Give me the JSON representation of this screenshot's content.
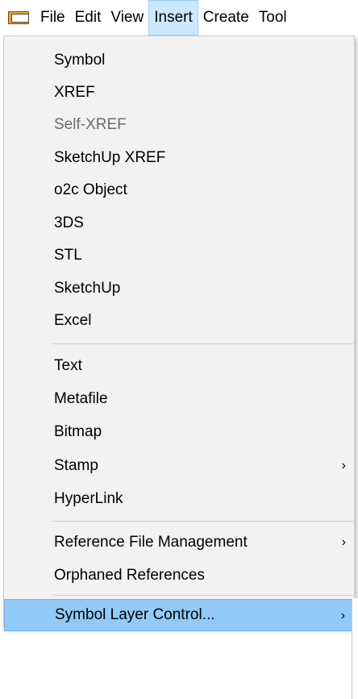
{
  "menubar": {
    "app_icon": "folder-window-icon",
    "items": [
      "File",
      "Edit",
      "View",
      "Insert",
      "Create",
      "Tool"
    ],
    "active_index": 3
  },
  "menu": {
    "groups": [
      [
        "Symbol",
        "XREF",
        "Self-XREF",
        "SketchUp XREF",
        "o2c Object",
        "3DS",
        "STL",
        "SketchUp",
        "Excel"
      ],
      [
        "Text",
        "Metafile",
        "Bitmap",
        "Stamp",
        "HyperLink"
      ],
      [
        "Reference File Management",
        "Orphaned References"
      ],
      [
        "Symbol Layer Control..."
      ]
    ],
    "disabled": [
      "Self-XREF"
    ],
    "has_submenu": [
      "Stamp",
      "Reference File Management",
      "Symbol Layer Control..."
    ],
    "highlighted": "Symbol Layer Control...",
    "submenu_glyph": "›"
  },
  "colors": {
    "menu_background": "#f2f2f2",
    "active_menubar": "#cce8ff",
    "highlight": "#91c9f7",
    "disabled_text": "#6d6d6d"
  }
}
